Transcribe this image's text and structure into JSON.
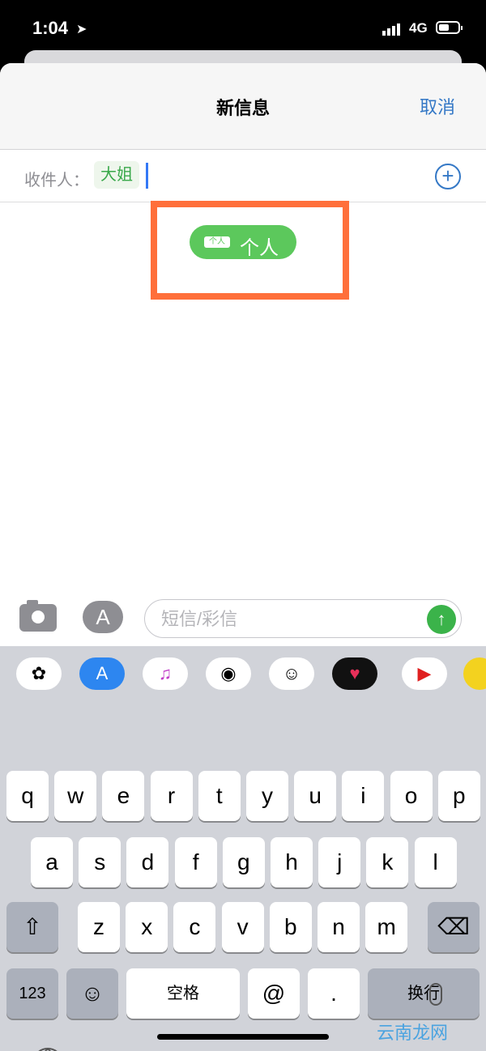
{
  "status": {
    "time": "1:04",
    "network": "4G"
  },
  "navbar": {
    "title": "新信息",
    "cancel": "取消"
  },
  "recipients": {
    "label": "收件人：",
    "chip": "大姐",
    "add_symbol": "+"
  },
  "bubble": {
    "tag": "个人",
    "text": "个人"
  },
  "compose": {
    "placeholder": "短信/彩信",
    "appstore_symbol": "A",
    "send_symbol": "↑"
  },
  "app_strip": [
    "photos",
    "app-store",
    "music",
    "monkey-memoji",
    "memoji-group",
    "digital-touch",
    "youtube",
    "more"
  ],
  "keyboard": {
    "row1": [
      "q",
      "w",
      "e",
      "r",
      "t",
      "y",
      "u",
      "i",
      "o",
      "p"
    ],
    "row2": [
      "a",
      "s",
      "d",
      "f",
      "g",
      "h",
      "j",
      "k",
      "l"
    ],
    "row3": [
      "z",
      "x",
      "c",
      "v",
      "b",
      "n",
      "m"
    ],
    "numbers": "123",
    "emoji": "☺",
    "space": "空格",
    "at": "@",
    "dot": ".",
    "return": "换行",
    "shift": "⇧",
    "backspace": "⌫"
  },
  "watermark": "云南龙网"
}
